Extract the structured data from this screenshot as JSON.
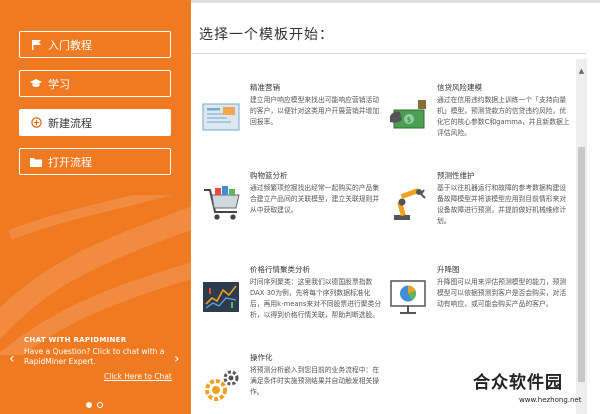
{
  "sidebar": {
    "items": [
      {
        "label": "入门教程",
        "icon": "flag-icon"
      },
      {
        "label": "学习",
        "icon": "graduation-cap-icon"
      },
      {
        "label": "新建流程",
        "icon": "plus-circle-icon",
        "active": true
      },
      {
        "label": "打开流程",
        "icon": "folder-icon"
      }
    ],
    "chat": {
      "title": "CHAT WITH RAPIDMINER",
      "body": "Have a Question? Click to chat with a RapidMiner Expert.",
      "link": "Click Here to Chat"
    },
    "arrows": {
      "prev": "‹",
      "next": "›"
    },
    "carousel_active_index": 0
  },
  "main": {
    "title": "选择一个模板开始：",
    "templates": [
      {
        "title": "精准营销",
        "desc": "建立用户响应模型来找出可能响应营销活动的客户，以便针对这类用户开展营销并增加回报率。",
        "icon": "marketing-icon"
      },
      {
        "title": "信贷风险建模",
        "desc": "通过在信用违约数据上训练一个「支持向量机」模型，预测贷款方的信贷违约风险，优化它的核心参数C和gamma，并且新数据上评估风险。",
        "icon": "credit-risk-icon"
      },
      {
        "title": "购物篮分析",
        "desc": "通过频繁项挖掘找出经常一起购买的产品集合建立产品间的关联模型，建立关联规则并从中获取建议。",
        "icon": "shopping-cart-icon"
      },
      {
        "title": "预测性维护",
        "desc": "基于以往机器运行和故障的参考数据构建设备故障模型并将该模型应用到目前情形来对设备故障进行预测，并提前做好机械维修计划。",
        "icon": "robot-arm-icon"
      },
      {
        "title": "价格行情聚类分析",
        "desc": "时间序列聚类：这里我们以德国股票指数DAX 30为例，先将每个序列数据标准化后，再用k-means来对不同股票进行聚类分析，以得到价格行情关联，帮助判断选股。",
        "icon": "candlestick-icon"
      },
      {
        "title": "升降图",
        "desc": "升降图可以用来评估预测模型的能力，预测模型可以依据预测到客户是否会购买，对活动有响应，或可能会购买产品的客户。",
        "icon": "pie-chart-icon"
      },
      {
        "title": "操作化",
        "desc": "将预测分析嵌入到您目前的业务流程中：在满足条件时实施预测结果并自动触发相关操作。",
        "icon": "gears-icon"
      }
    ],
    "scroll_up": "▲"
  },
  "watermark": {
    "text": "合众软件园",
    "url": "www.hezhong.net"
  },
  "colors": {
    "accent": "#f07a22",
    "text": "#333333",
    "muted": "#555555"
  }
}
